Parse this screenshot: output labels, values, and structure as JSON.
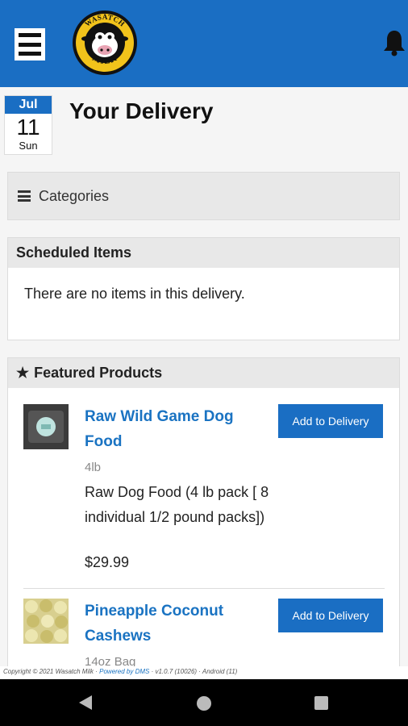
{
  "header": {
    "menu_icon": "hamburger-icon",
    "logo_top_text": "WASATCH",
    "logo_bottom_text": "MILK",
    "bell_icon": "bell-icon",
    "color": "#1a6ec3"
  },
  "date": {
    "month": "Jul",
    "day": "11",
    "weekday": "Sun"
  },
  "page_title": "Your Delivery",
  "categories": {
    "label": "Categories",
    "icon": "list-icon"
  },
  "scheduled": {
    "title": "Scheduled Items",
    "empty_message": "There are no items in this delivery."
  },
  "featured": {
    "title": "Featured Products",
    "icon": "star-icon",
    "products": [
      {
        "name": "Raw Wild Game Dog Food",
        "size": "4lb",
        "description": "Raw Dog Food (4 lb pack [ 8 individual 1/2 pound packs])",
        "price": "$29.99",
        "button": "Add to Delivery"
      },
      {
        "name": "Pineapple Coconut Cashews",
        "size": "14oz Bag",
        "button": "Add to Delivery"
      }
    ]
  },
  "footer": {
    "copyright": "Copyright © 2021 Wasatch Milk · ",
    "powered": "Powered by DMS",
    "version": " · v1.0.7 (10026) · Android (11)"
  },
  "nav": {
    "back_icon": "back-icon",
    "home_icon": "home-icon",
    "recent_icon": "recent-apps-icon"
  }
}
